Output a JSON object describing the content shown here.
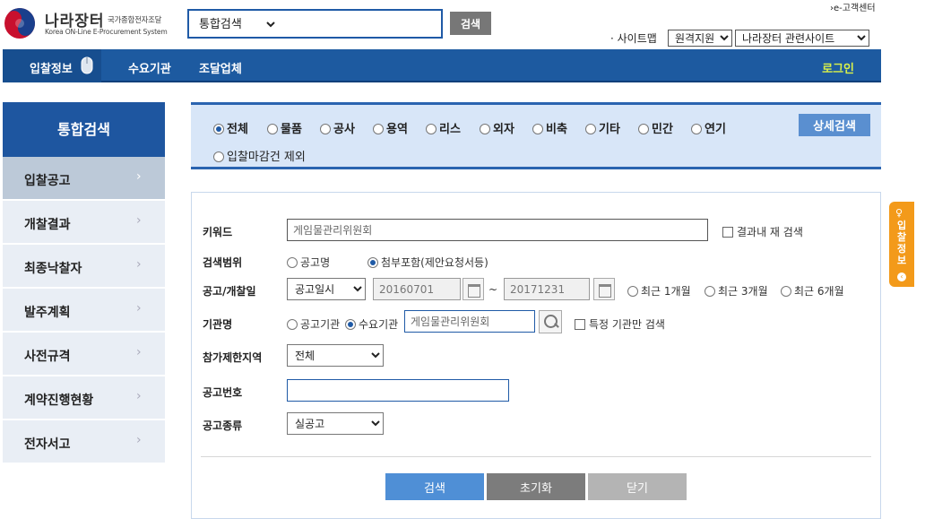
{
  "header": {
    "logo_ko": "나라장터",
    "logo_sub": "국가종합전자조달",
    "logo_en": "Korea ON-Line E-Procurement System",
    "search_select": "통합검색",
    "search_button": "검색",
    "customer_center": "›e-고객센터",
    "sitemap": "· 사이트맵",
    "remote_support": "원격지원",
    "related_sites": "나라장터 관련사이트"
  },
  "gnb": {
    "items": [
      "입찰정보",
      "수요기관",
      "조달업체"
    ],
    "login": "로그인"
  },
  "lnb": {
    "title": "통합검색",
    "items": [
      "입찰공고",
      "개찰결과",
      "최종낙찰자",
      "발주계획",
      "사전규격",
      "계약진행현황",
      "전자서고"
    ]
  },
  "categories": {
    "items": [
      "전체",
      "물품",
      "공사",
      "용역",
      "리스",
      "외자",
      "비축",
      "기타",
      "민간",
      "연기"
    ],
    "exclude_closed": "입찰마감건 제외",
    "detail_search": "상세검색"
  },
  "form": {
    "keyword_label": "키워드",
    "keyword_value": "게임물관리위원회",
    "research_label": "결과내 재 검색",
    "scope_label": "검색범위",
    "scope_options": [
      "공고명",
      "첨부포함(제안요청서등)"
    ],
    "date_label": "공고/개찰일",
    "date_type": "공고일시",
    "date_from": "20160701",
    "date_sep": "~",
    "date_to": "20171231",
    "date_presets": [
      "최근 1개월",
      "최근 3개월",
      "최근 6개월"
    ],
    "org_label": "기관명",
    "org_options": [
      "공고기관",
      "수요기관"
    ],
    "org_value": "게임물관리위원회",
    "org_only_label": "특정 기관만 검색",
    "region_label": "참가제한지역",
    "region_value": "전체",
    "notice_no_label": "공고번호",
    "notice_no_value": "",
    "notice_type_label": "공고종류",
    "notice_type_value": "실공고",
    "buttons": {
      "search": "검색",
      "reset": "초기화",
      "close": "닫기"
    }
  },
  "side_tab": {
    "icon": "bulb-icon",
    "text": "입찰정보"
  }
}
